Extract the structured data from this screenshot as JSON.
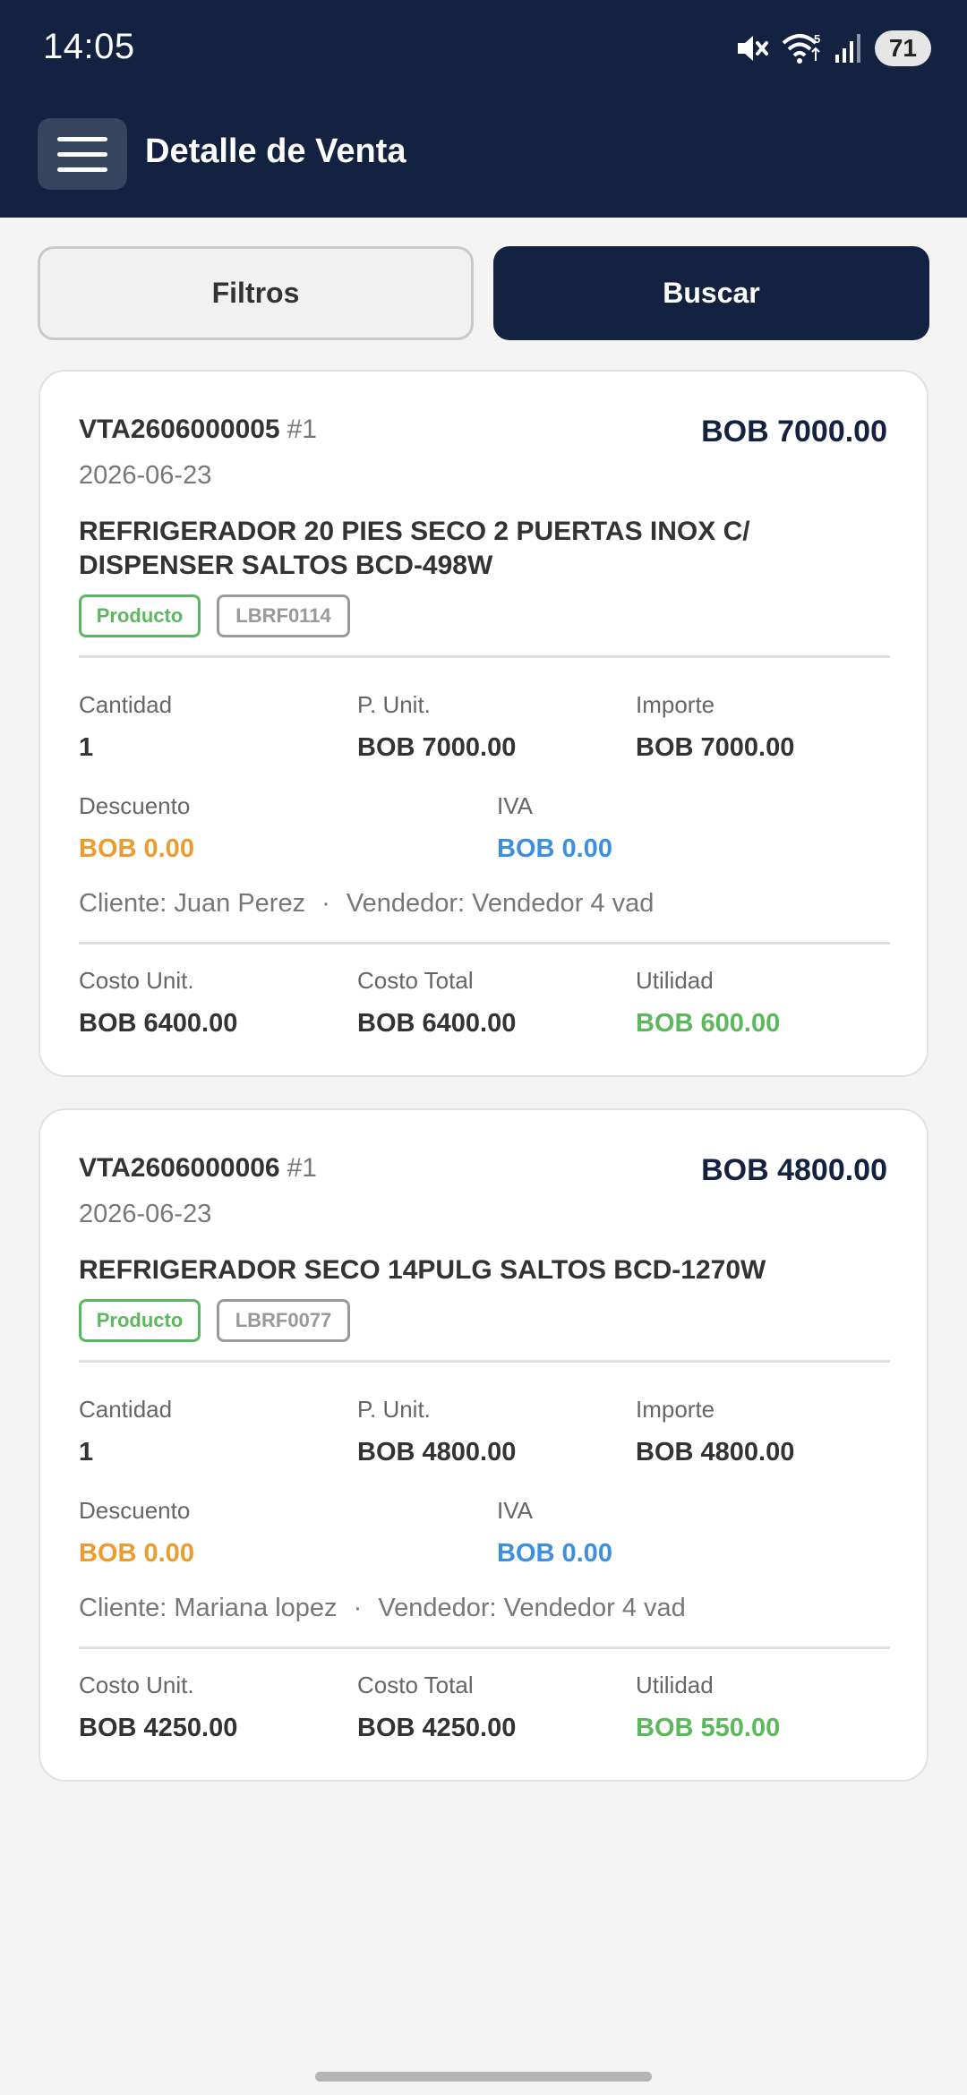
{
  "status_bar": {
    "time": "14:05",
    "battery": "71",
    "signal_badge": "5"
  },
  "header": {
    "title": "Detalle de Venta"
  },
  "actions": {
    "filters_label": "Filtros",
    "search_label": "Buscar"
  },
  "labels": {
    "cantidad": "Cantidad",
    "p_unit": "P. Unit.",
    "importe": "Importe",
    "descuento": "Descuento",
    "iva": "IVA",
    "costo_unit": "Costo Unit.",
    "costo_total": "Costo Total",
    "utilidad": "Utilidad",
    "dot": "·"
  },
  "sales": [
    {
      "code": "VTA2606000005",
      "line": "#1",
      "total": "BOB 7000.00",
      "date": "2026-06-23",
      "product": "REFRIGERADOR 20 PIES SECO 2 PUERTAS INOX C/ DISPENSER SALTOS BCD-498W",
      "type_tag": "Producto",
      "sku": "LBRF0114",
      "cantidad": "1",
      "p_unit": "BOB 7000.00",
      "importe": "BOB 7000.00",
      "descuento": "BOB 0.00",
      "iva": "BOB 0.00",
      "cliente": "Cliente: Juan Perez",
      "vendedor": "Vendedor: Vendedor 4 vad",
      "costo_unit": "BOB 6400.00",
      "costo_total": "BOB 6400.00",
      "utilidad": "BOB 600.00"
    },
    {
      "code": "VTA2606000006",
      "line": "#1",
      "total": "BOB 4800.00",
      "date": "2026-06-23",
      "product": "REFRIGERADOR SECO 14PULG SALTOS BCD-1270W",
      "type_tag": "Producto",
      "sku": "LBRF0077",
      "cantidad": "1",
      "p_unit": "BOB 4800.00",
      "importe": "BOB 4800.00",
      "descuento": "BOB 0.00",
      "iva": "BOB 0.00",
      "cliente": "Cliente: Mariana lopez",
      "vendedor": "Vendedor: Vendedor 4 vad",
      "costo_unit": "BOB 4250.00",
      "costo_total": "BOB 4250.00",
      "utilidad": "BOB 550.00"
    }
  ],
  "colors": {
    "header_bg": "#132241",
    "accent_green": "#5cb85c",
    "accent_orange": "#ec9c2f",
    "accent_blue": "#3d8fe0"
  },
  "icons": [
    "mute-icon",
    "wifi-icon",
    "signal-icon",
    "battery-icon",
    "menu-icon"
  ]
}
